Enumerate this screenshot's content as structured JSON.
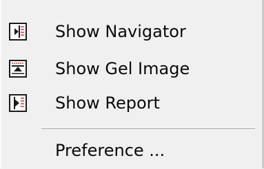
{
  "menu": {
    "items": [
      {
        "label": "Show Navigator",
        "icon": "navigator-icon"
      },
      {
        "label": "Show Gel Image",
        "icon": "gel-image-icon"
      },
      {
        "label": "Show Report",
        "icon": "report-icon"
      }
    ],
    "preference_label": "Preference ..."
  },
  "colors": {
    "menu_bg": "#f0f0f0",
    "text": "#0a0a0a",
    "icon_border": "#1a1a1a",
    "icon_accent": "#e03030"
  }
}
